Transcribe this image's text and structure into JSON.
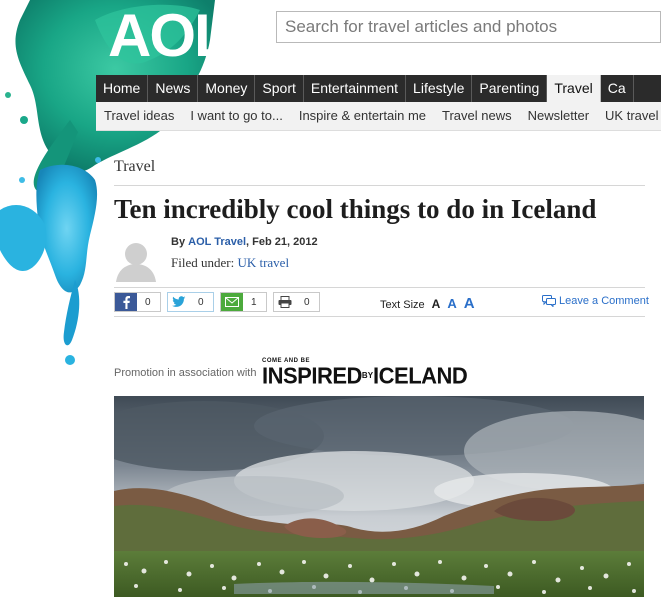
{
  "brand": {
    "logo_text": "AOL"
  },
  "search": {
    "placeholder": "Search for travel articles and photos"
  },
  "main_nav": {
    "items": [
      {
        "label": "Home"
      },
      {
        "label": "News"
      },
      {
        "label": "Money"
      },
      {
        "label": "Sport"
      },
      {
        "label": "Entertainment"
      },
      {
        "label": "Lifestyle"
      },
      {
        "label": "Parenting"
      },
      {
        "label": "Travel",
        "active": true
      },
      {
        "label": "Ca"
      }
    ]
  },
  "sub_nav": {
    "items": [
      {
        "label": "Travel ideas"
      },
      {
        "label": "I want to go to..."
      },
      {
        "label": "Inspire & entertain me"
      },
      {
        "label": "Travel news"
      },
      {
        "label": "Newsletter"
      },
      {
        "label": "UK travel"
      }
    ]
  },
  "article": {
    "section": "Travel",
    "title": "Ten incredibly cool things to do in Iceland",
    "byline_prefix": "By",
    "author": "AOL Travel",
    "date": ", Feb 21, 2012",
    "filed_label": "Filed under:",
    "filed_tag": "UK travel"
  },
  "share": {
    "facebook": {
      "icon": "facebook-icon",
      "count": "0"
    },
    "twitter": {
      "icon": "twitter-bird-icon",
      "count": "0"
    },
    "email": {
      "icon": "envelope-icon",
      "count": "1"
    },
    "print": {
      "icon": "printer-icon",
      "count": "0"
    },
    "text_size_label": "Text Size",
    "size_small": "A",
    "size_medium": "A",
    "size_large": "A",
    "comment_label": "Leave a Comment"
  },
  "promo": {
    "text": "Promotion in association with",
    "logo_small": "COME AND BE",
    "logo_main_1": "INSPIRED",
    "logo_main_by": "BY",
    "logo_main_2": "ICELAND"
  },
  "colors": {
    "nav_bg": "#2b2b2b",
    "link_blue": "#2a5ea8",
    "splash_green": "#1fb08c",
    "splash_blue": "#2ab3e0"
  }
}
